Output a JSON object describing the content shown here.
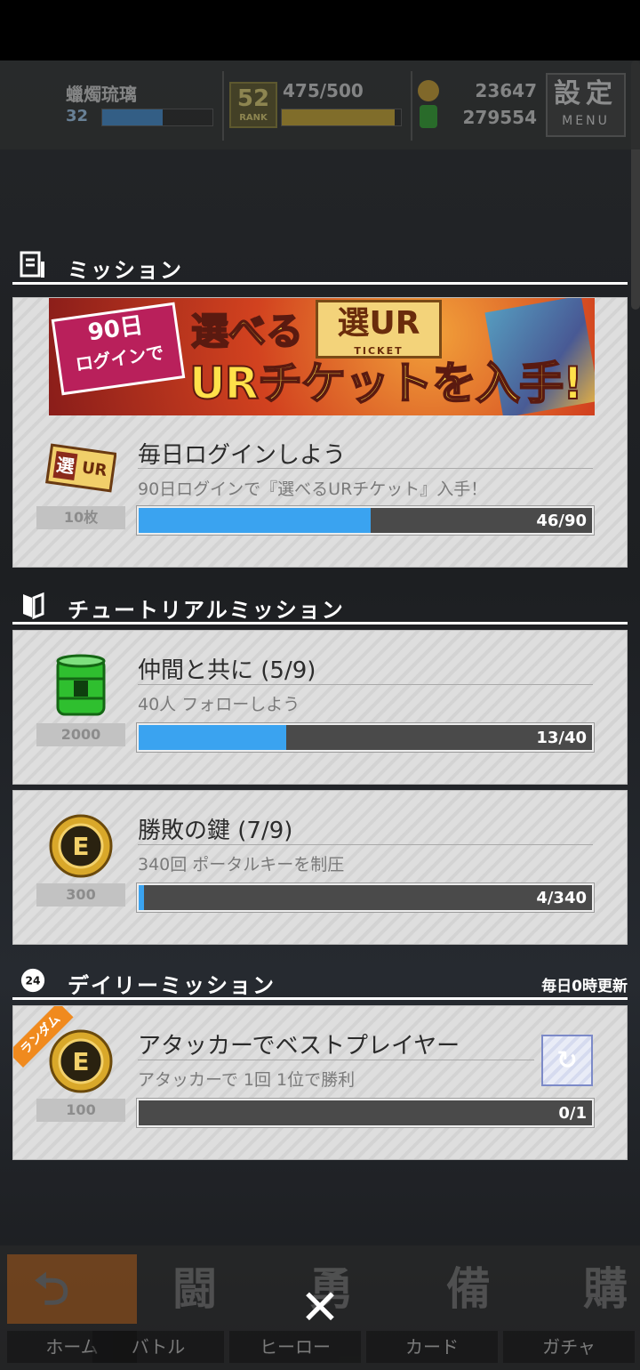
{
  "hud": {
    "player_name": "蠟燭琉璃",
    "level": "32",
    "rank": "52",
    "rank_label": "RANK",
    "stamina": "475/500",
    "coins": "23647",
    "gems": "279554",
    "menu_label": "設定",
    "menu_sub": "MENU"
  },
  "sections": {
    "mission": {
      "title": "ミッション"
    },
    "tutorial": {
      "title": "チュートリアルミッション"
    },
    "daily": {
      "title": "デイリーミッション",
      "note": "毎日0時更新"
    }
  },
  "banner": {
    "tag_line1": "90日",
    "tag_line2": "ログインで",
    "line1": "選べる",
    "ticket_kanji": "選UR",
    "ticket_label": "TICKET",
    "line2": "URチケットを入手!"
  },
  "missions": [
    {
      "title": "毎日ログインしよう",
      "subtitle": "90日ログインで『選べるURチケット』入手！",
      "reward": "10枚",
      "progress_text": "46/90",
      "progress": 0.511,
      "icon": "ur-ticket-icon"
    },
    {
      "title": "仲間と共に (5/9)",
      "subtitle": "40人 フォローしよう",
      "reward": "2000",
      "progress_text": "13/40",
      "progress": 0.325,
      "icon": "green-canister-icon"
    },
    {
      "title": "勝敗の鍵 (7/9)",
      "subtitle": "340回 ポータルキーを制圧",
      "reward": "300",
      "progress_text": "4/340",
      "progress": 0.012,
      "icon": "gold-coin-icon"
    },
    {
      "title": "アタッカーでベストプレイヤー",
      "subtitle": "アタッカーで 1回 1位で勝利",
      "reward": "100",
      "progress_text": "0/1",
      "progress": 0,
      "icon": "gold-coin-icon",
      "tag": "ランダム"
    }
  ],
  "nav": [
    {
      "kanji": "",
      "label": "ホーム"
    },
    {
      "kanji": "闘",
      "label": "バトル"
    },
    {
      "kanji": "勇",
      "label": "ヒーロー"
    },
    {
      "kanji": "備",
      "label": "カード"
    },
    {
      "kanji": "購",
      "label": "ガチャ"
    }
  ],
  "colors": {
    "progress": "#3aa3f0",
    "accent_orange": "#f08a1e",
    "gold": "#d9a82a",
    "green": "#2fbf2f"
  }
}
